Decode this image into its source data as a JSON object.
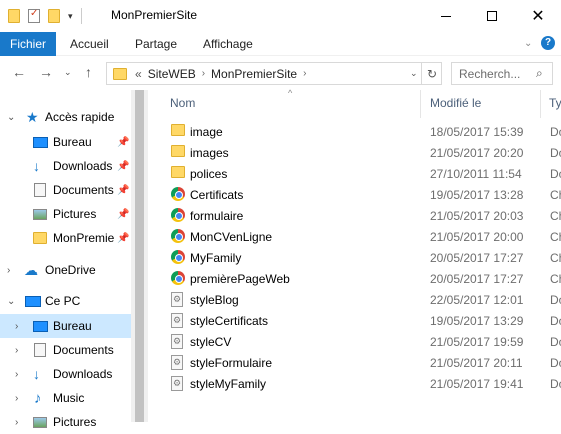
{
  "window": {
    "title": "MonPremierSite"
  },
  "ribbon": {
    "tabs": [
      "Fichier",
      "Accueil",
      "Partage",
      "Affichage"
    ]
  },
  "address": {
    "crumbs": [
      "SiteWEB",
      "MonPremierSite"
    ],
    "prefix": "«",
    "search_placeholder": "Recherch..."
  },
  "sidebar": {
    "quick_access": {
      "label": "Accès rapide",
      "items": [
        {
          "label": "Bureau",
          "icon": "desktop-icon",
          "pinned": true
        },
        {
          "label": "Downloads",
          "icon": "download-icon",
          "pinned": true
        },
        {
          "label": "Documents",
          "icon": "documents-icon",
          "pinned": true
        },
        {
          "label": "Pictures",
          "icon": "pictures-icon",
          "pinned": true
        },
        {
          "label": "MonPremie",
          "icon": "folder-icon",
          "pinned": true
        }
      ]
    },
    "onedrive": {
      "label": "OneDrive"
    },
    "this_pc": {
      "label": "Ce PC",
      "items": [
        {
          "label": "Bureau",
          "selected": true
        },
        {
          "label": "Documents"
        },
        {
          "label": "Downloads"
        },
        {
          "label": "Music"
        },
        {
          "label": "Pictures"
        }
      ]
    }
  },
  "columns": {
    "name": "Nom",
    "modified": "Modifié le",
    "type": "Ty"
  },
  "files": [
    {
      "name": "image",
      "modified": "18/05/2017 15:39",
      "type": "Do",
      "icon": "folder-icon"
    },
    {
      "name": "images",
      "modified": "21/05/2017 20:20",
      "type": "Do",
      "icon": "folder-icon"
    },
    {
      "name": "polices",
      "modified": "27/10/2011 11:54",
      "type": "Do",
      "icon": "folder-icon"
    },
    {
      "name": "Certificats",
      "modified": "19/05/2017 13:28",
      "type": "Ch",
      "icon": "chrome-icon"
    },
    {
      "name": "formulaire",
      "modified": "21/05/2017 20:03",
      "type": "Ch",
      "icon": "chrome-icon"
    },
    {
      "name": "MonCVenLigne",
      "modified": "21/05/2017 20:00",
      "type": "Ch",
      "icon": "chrome-icon"
    },
    {
      "name": "MyFamily",
      "modified": "20/05/2017 17:27",
      "type": "Ch",
      "icon": "chrome-icon"
    },
    {
      "name": "premièrePageWeb",
      "modified": "20/05/2017 17:27",
      "type": "Ch",
      "icon": "chrome-icon"
    },
    {
      "name": "styleBlog",
      "modified": "22/05/2017 12:01",
      "type": "Do",
      "icon": "css-file-icon"
    },
    {
      "name": "styleCertificats",
      "modified": "19/05/2017 13:29",
      "type": "Do",
      "icon": "css-file-icon"
    },
    {
      "name": "styleCV",
      "modified": "21/05/2017 19:59",
      "type": "Do",
      "icon": "css-file-icon"
    },
    {
      "name": "styleFormulaire",
      "modified": "21/05/2017 20:11",
      "type": "Do",
      "icon": "css-file-icon"
    },
    {
      "name": "styleMyFamily",
      "modified": "21/05/2017 19:41",
      "type": "Do",
      "icon": "css-file-icon"
    }
  ],
  "colors": {
    "accent": "#1979ca",
    "selection": "#cce8ff",
    "folder": "#ffd866"
  }
}
